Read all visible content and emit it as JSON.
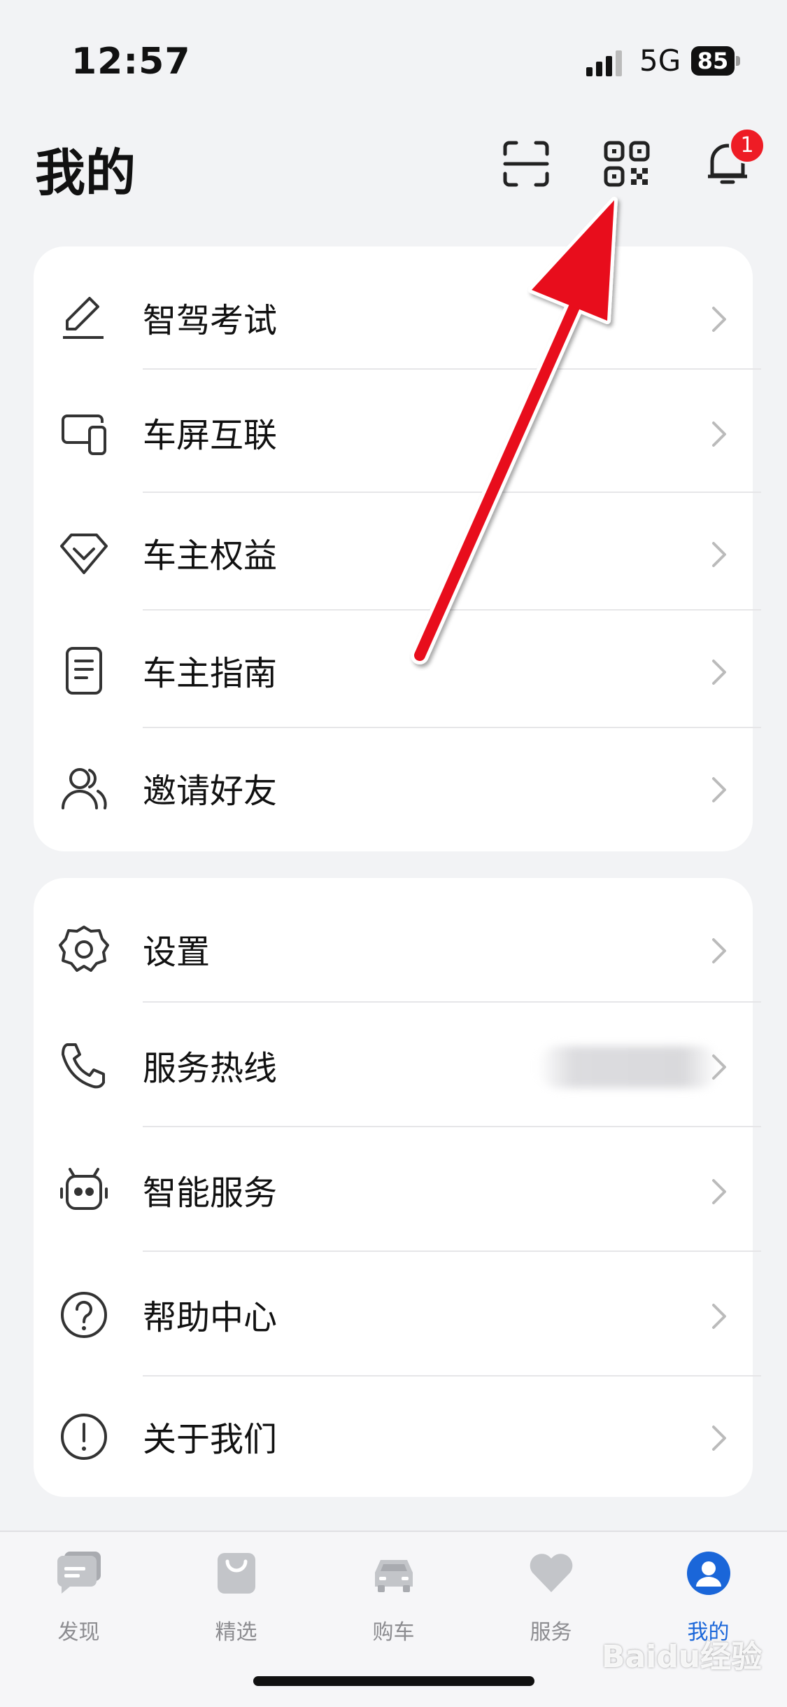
{
  "status_bar": {
    "time": "12:57",
    "network": "5G",
    "battery": "85"
  },
  "header": {
    "title": "我的",
    "notification_count": "1"
  },
  "menu_group_1": [
    {
      "label": "智驾考试",
      "icon": "pencil-icon"
    },
    {
      "label": "车屏互联",
      "icon": "devices-icon"
    },
    {
      "label": "车主权益",
      "icon": "diamond-icon"
    },
    {
      "label": "车主指南",
      "icon": "document-icon"
    },
    {
      "label": "邀请好友",
      "icon": "people-icon"
    }
  ],
  "menu_group_2": [
    {
      "label": "设置",
      "icon": "gear-icon"
    },
    {
      "label": "服务热线",
      "icon": "phone-icon"
    },
    {
      "label": "智能服务",
      "icon": "robot-icon"
    },
    {
      "label": "帮助中心",
      "icon": "question-icon"
    },
    {
      "label": "关于我们",
      "icon": "info-icon"
    }
  ],
  "tabs": [
    {
      "label": "发现",
      "icon": "chat-icon",
      "active": false
    },
    {
      "label": "精选",
      "icon": "bag-icon",
      "active": false
    },
    {
      "label": "购车",
      "icon": "car-icon",
      "active": false
    },
    {
      "label": "服务",
      "icon": "heart-icon",
      "active": false
    },
    {
      "label": "我的",
      "icon": "profile-icon",
      "active": true
    }
  ],
  "watermark": "Baidu经验",
  "colors": {
    "accent": "#1a66d9",
    "badge": "#ee1c25",
    "arrow": "#e8101a",
    "background": "#f2f3f5"
  }
}
